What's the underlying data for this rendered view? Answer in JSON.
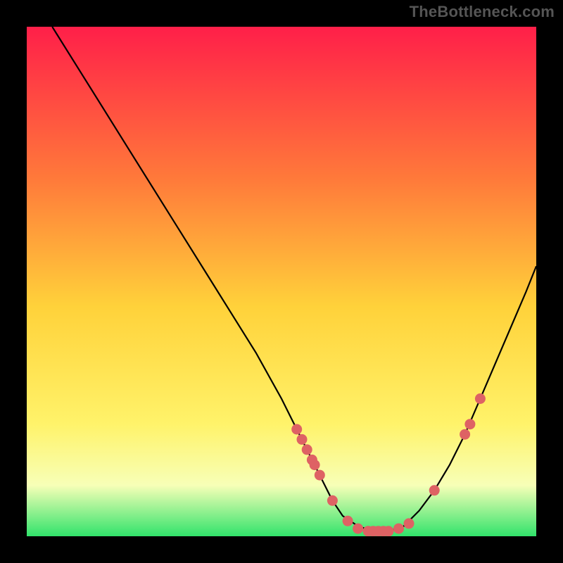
{
  "attribution": "TheBottleneck.com",
  "colors": {
    "grad_top": "#ff1f49",
    "grad_mid_upper": "#ff7a3a",
    "grad_mid": "#ffd23a",
    "grad_lower": "#fff36a",
    "grad_pale": "#f7ffb7",
    "grad_bottom": "#31e36b",
    "curve": "#000000",
    "marker": "#de6264",
    "border": "#000000"
  },
  "chart_data": {
    "type": "line",
    "title": "",
    "xlabel": "",
    "ylabel": "",
    "xlim": [
      0,
      100
    ],
    "ylim": [
      0,
      100
    ],
    "curve": {
      "x": [
        5,
        10,
        15,
        20,
        25,
        30,
        35,
        40,
        45,
        50,
        53,
        56,
        58,
        60,
        62,
        65,
        68,
        71,
        74,
        77,
        80,
        83,
        86,
        89,
        92,
        95,
        98,
        100
      ],
      "y": [
        100,
        92,
        84,
        76,
        68,
        60,
        52,
        44,
        36,
        27,
        21,
        15,
        11,
        7,
        4,
        2,
        1,
        1,
        2,
        5,
        9,
        14,
        20,
        27,
        34,
        41,
        48,
        53
      ]
    },
    "markers": {
      "x": [
        53,
        54,
        55,
        56,
        56.5,
        57.5,
        60,
        63,
        65,
        67,
        68,
        69,
        70,
        71,
        73,
        75,
        80,
        86,
        87,
        89
      ],
      "y": [
        21,
        19,
        17,
        15,
        14,
        12,
        7,
        3,
        1.5,
        1,
        1,
        1,
        1,
        1,
        1.5,
        2.5,
        9,
        20,
        22,
        27
      ]
    }
  }
}
